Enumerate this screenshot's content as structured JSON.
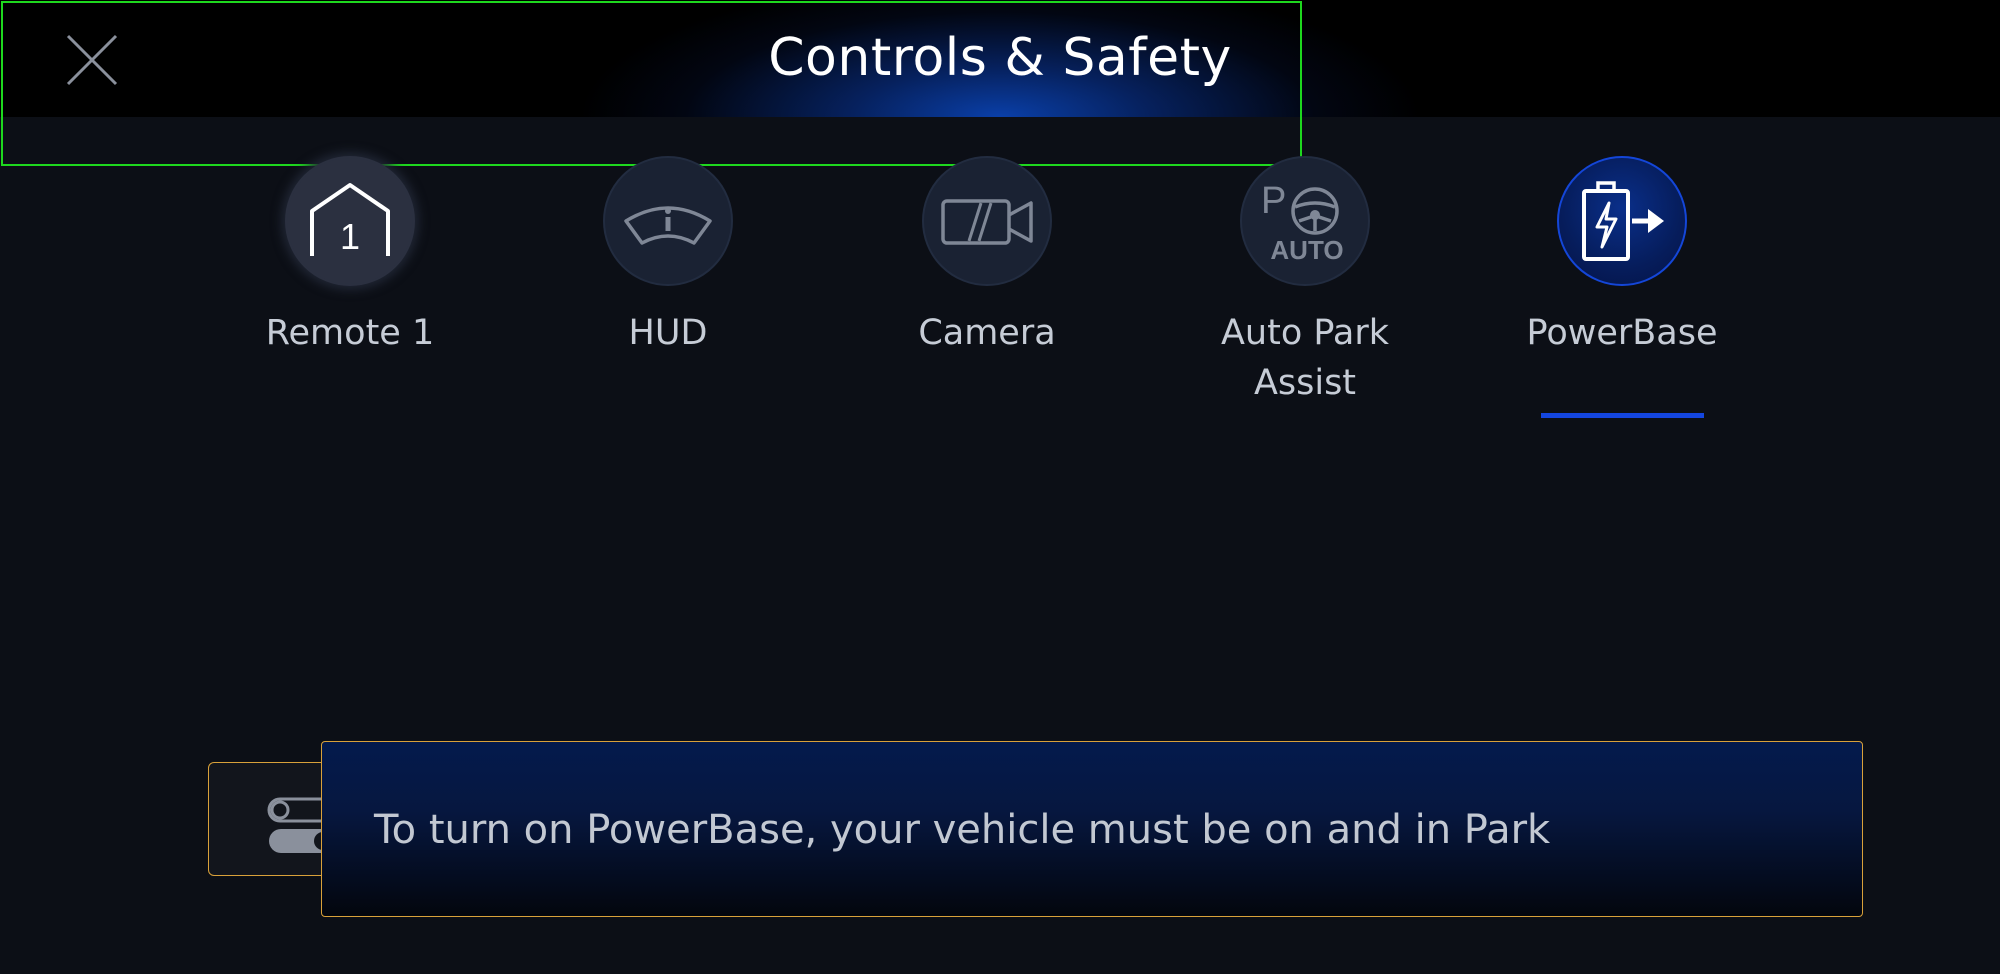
{
  "header": {
    "title": "Controls & Safety",
    "close_icon": "close-icon"
  },
  "tabs": [
    {
      "label": "Remote 1",
      "icon": "garage-remote-icon",
      "active": false
    },
    {
      "label": "HUD",
      "icon": "windshield-info-icon",
      "active": false
    },
    {
      "label": "Camera",
      "icon": "camera-icon",
      "active": false
    },
    {
      "label": "Auto Park Assist",
      "label_line1": "Auto Park",
      "label_line2": "Assist",
      "icon": "auto-park-icon",
      "active": false
    },
    {
      "label": "PowerBase",
      "icon": "powerbase-battery-icon",
      "active": true
    }
  ],
  "remote_badge": "1",
  "auto_park_glyphs": {
    "p": "P",
    "auto": "AUTO"
  },
  "notice": {
    "text": "To turn on PowerBase, your vehicle must be on and in Park",
    "icon": "toggle-icon"
  },
  "colors": {
    "accent_blue": "#1446e0",
    "notice_border": "#d9a13a",
    "highlight": "#1ed81e",
    "background": "#0c0f16"
  }
}
